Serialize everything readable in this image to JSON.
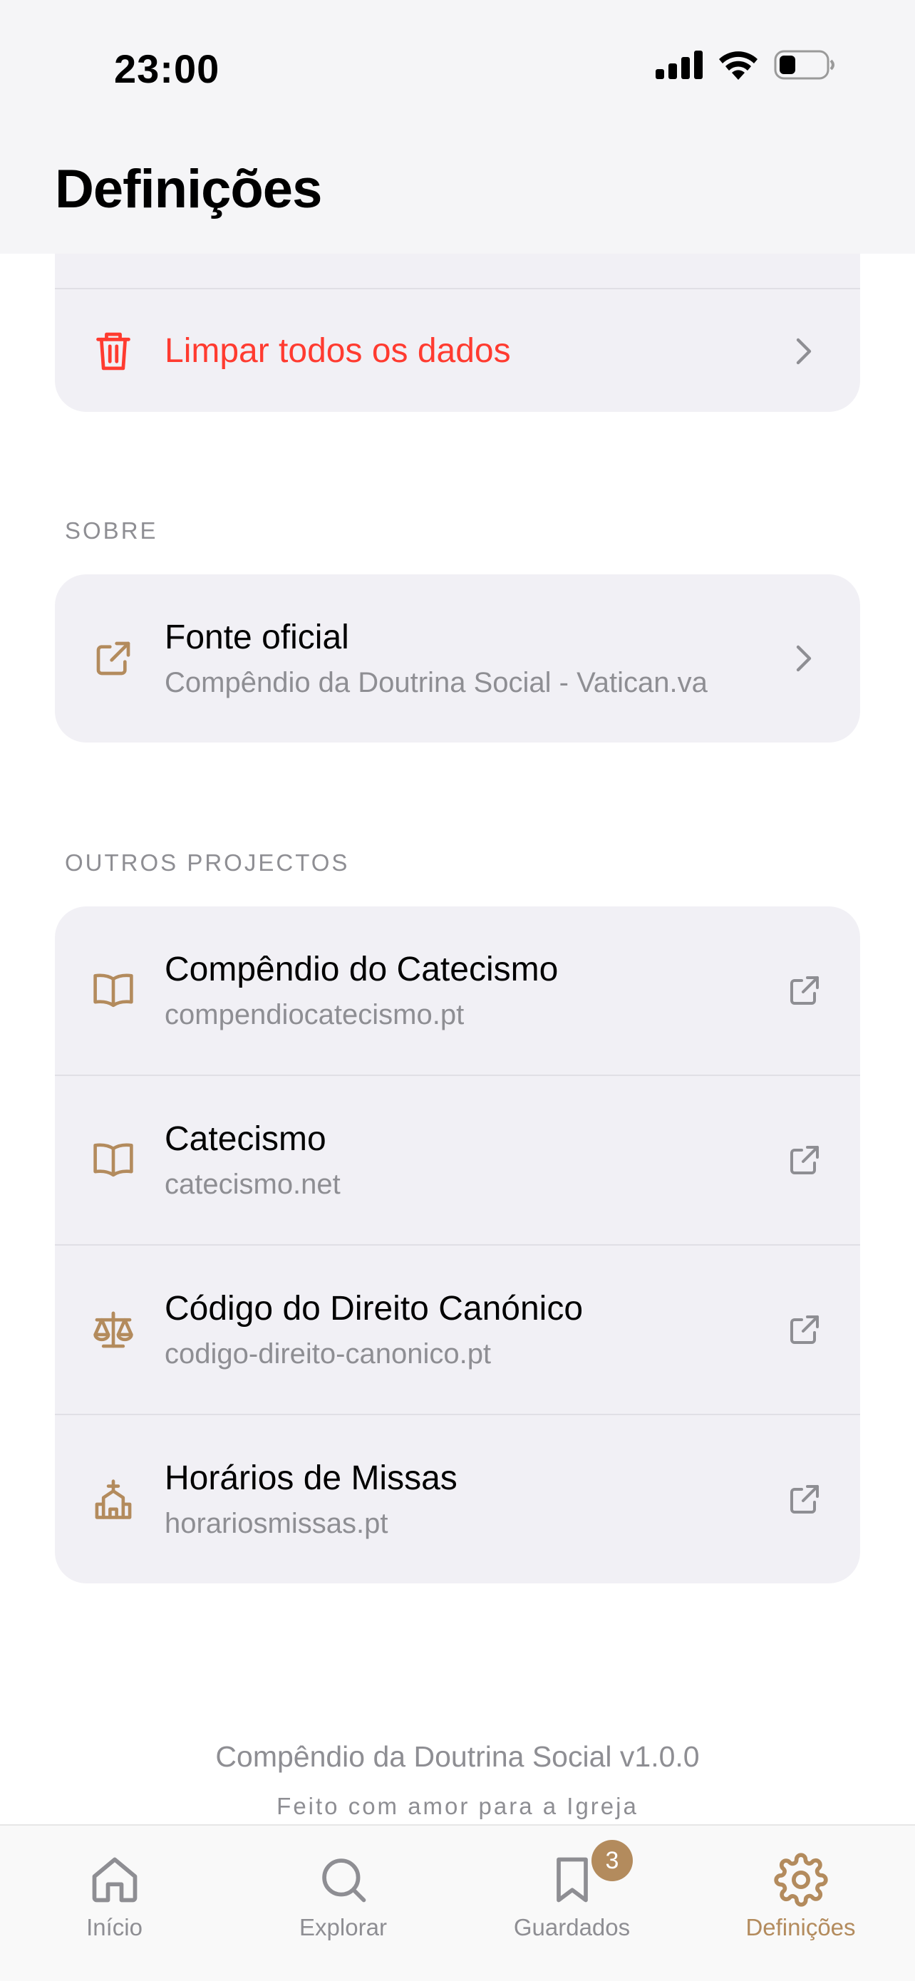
{
  "status_bar": {
    "time": "23:00"
  },
  "header": {
    "title": "Definições"
  },
  "data_section": {
    "clear_all": "Limpar todos os dados"
  },
  "about": {
    "label": "SOBRE",
    "official_source": {
      "title": "Fonte oficial",
      "subtitle": "Compêndio da Doutrina Social - Vatican.va"
    }
  },
  "other_projects": {
    "label": "OUTROS PROJECTOS",
    "items": [
      {
        "title": "Compêndio do Catecismo",
        "subtitle": "compendiocatecismo.pt",
        "icon": "book-icon"
      },
      {
        "title": "Catecismo",
        "subtitle": "catecismo.net",
        "icon": "book-icon"
      },
      {
        "title": "Código do Direito Canónico",
        "subtitle": "codigo-direito-canonico.pt",
        "icon": "scale-icon"
      },
      {
        "title": "Horários de Missas",
        "subtitle": "horariosmissas.pt",
        "icon": "church-icon"
      }
    ]
  },
  "footer": {
    "title": "Compêndio da Doutrina Social v1.0.0",
    "subtitle": "Feito com amor para a Igreja"
  },
  "tabbar": {
    "tabs": [
      {
        "label": "Início",
        "icon": "home-icon"
      },
      {
        "label": "Explorar",
        "icon": "search-icon"
      },
      {
        "label": "Guardados",
        "icon": "bookmark-icon",
        "badge": "3"
      },
      {
        "label": "Definições",
        "icon": "gear-icon",
        "active": true
      }
    ]
  },
  "colors": {
    "accent": "#b38b5d",
    "destructive": "#ff3b30",
    "secondary_text": "#8e8e93",
    "card_background": "#f1f0f5"
  }
}
